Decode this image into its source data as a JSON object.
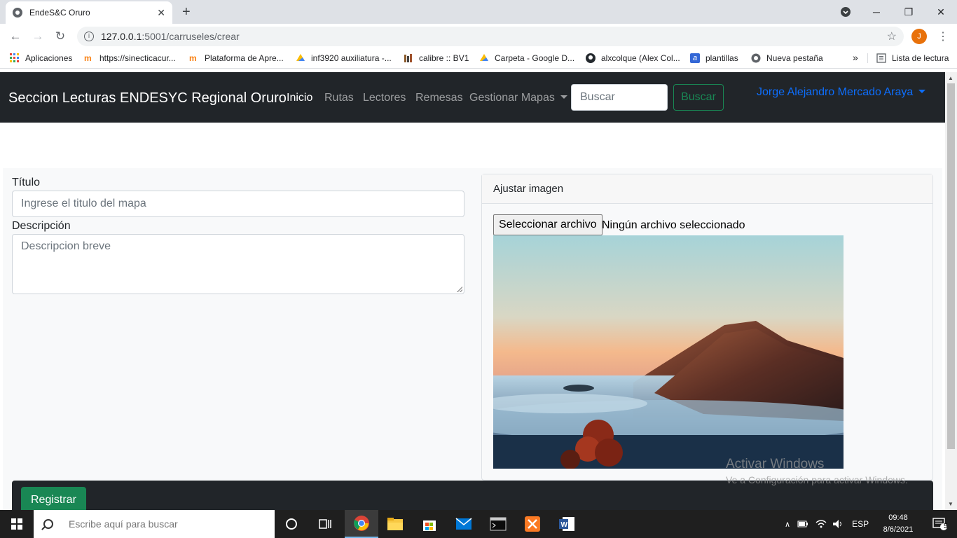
{
  "browser": {
    "tab_title": "EndeS&C Oruro",
    "tab_close": "✕",
    "new_tab": "+",
    "url_host": "127.0.0.1",
    "url_path": ":5001/carruseles/crear",
    "profile_initial": "J",
    "window_controls": {
      "minimize": "─",
      "maximize": "❐",
      "close": "✕"
    }
  },
  "bookmarks": [
    {
      "label": "Aplicaciones",
      "icon": "apps-grid-icon",
      "color": "#ea4335"
    },
    {
      "label": "https://sinecticacur...",
      "icon": "moodle-icon",
      "color": "#f98012"
    },
    {
      "label": "Plataforma de Apre...",
      "icon": "moodle-icon",
      "color": "#f98012"
    },
    {
      "label": "inf3920 auxiliatura -...",
      "icon": "google-drive-icon",
      "color": "#1fa463"
    },
    {
      "label": "calibre :: BV1",
      "icon": "calibre-icon",
      "color": "#8b5a2b"
    },
    {
      "label": "Carpeta - Google D...",
      "icon": "google-drive-icon",
      "color": "#1fa463"
    },
    {
      "label": "alxcolque (Alex Col...",
      "icon": "github-icon",
      "color": "#24292e"
    },
    {
      "label": "plantillas",
      "icon": "bookmark-a-icon",
      "color": "#3367d6"
    },
    {
      "label": "Nueva pestaña",
      "icon": "globe-icon",
      "color": "#5f6368"
    }
  ],
  "bookmarks_overflow": "»",
  "reading_list": "Lista de lectura",
  "navbar": {
    "brand": "Seccion Lecturas ENDESYC Regional Oruro",
    "links": [
      {
        "label": "Inicio",
        "active": true
      },
      {
        "label": "Rutas",
        "active": false
      },
      {
        "label": "Lectores",
        "active": false
      },
      {
        "label": "Remesas",
        "active": false
      }
    ],
    "dropdown_label": "Gestionar Mapas",
    "search_placeholder": "Buscar",
    "search_button": "Buscar",
    "user_name": "Jorge Alejandro Mercado Araya"
  },
  "form": {
    "title_label": "Título",
    "title_placeholder": "Ingrese el titulo del mapa",
    "description_label": "Descripción",
    "description_placeholder": "Descripcion breve",
    "image_card_header": "Ajustar imagen",
    "file_button": "Seleccionar archivo",
    "file_status": "Ningún archivo seleccionado",
    "submit_button": "Registrar"
  },
  "watermark": {
    "line1": "Activar Windows",
    "line2": "Ve a Configuración para activar Windows."
  },
  "taskbar": {
    "search_placeholder": "Escribe aquí para buscar",
    "language": "ESP",
    "time": "09:48",
    "date": "8/6/2021",
    "notifications": "5"
  },
  "colors": {
    "navbar_bg": "#212529",
    "success": "#198754",
    "user_link": "#0d6efd",
    "page_bg": "#f8f9fa"
  }
}
